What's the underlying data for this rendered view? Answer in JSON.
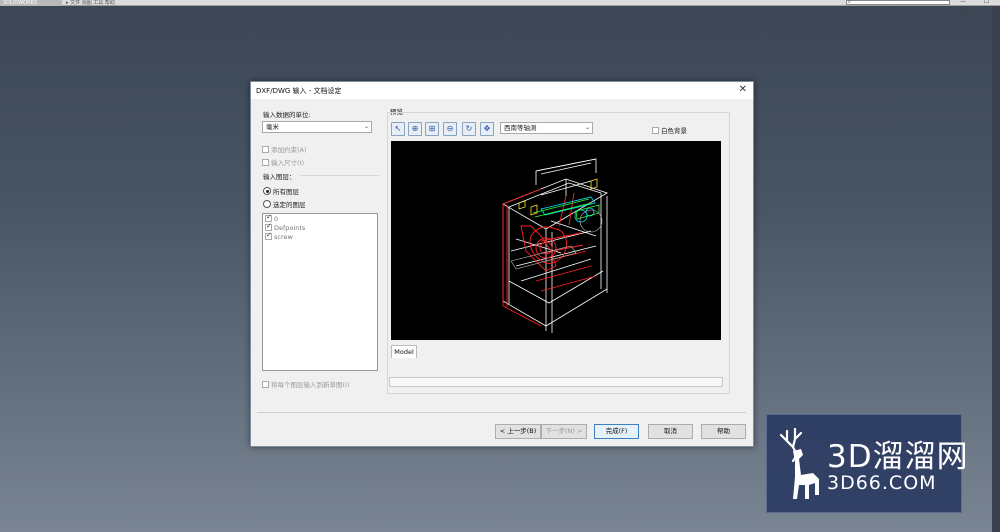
{
  "app": {
    "name": "SOLIDWORKS",
    "menus": "▸  文件  视图  工具  帮助",
    "window_controls": "—  ☐  ✕"
  },
  "dialog": {
    "title": "DXF/DWG 输入 - 文档设定",
    "close_glyph": "✕",
    "units_label": "输入数据的单位:",
    "units_value": "毫米",
    "add_constraints": "添加约束(A)",
    "import_dimensions": "输入尺寸(I)",
    "import_layers_label": "输入图层：",
    "all_layers": "所有图层",
    "selected_layers": "选定的图层",
    "layers": [
      {
        "name": "0",
        "checked": true
      },
      {
        "name": "Defpoints",
        "checked": true
      },
      {
        "name": "screw",
        "checked": true
      }
    ],
    "each_layer_new_sketch": "将每个图层输入到新草图(I)",
    "preview_label": "预览",
    "view_combo": "西南等轴测",
    "white_background": "白色背景",
    "model_tab": "Model",
    "buttons": {
      "back": "< 上一步(B)",
      "next": "下一步(N) >",
      "finish": "完成(F)",
      "cancel": "取消",
      "help": "帮助"
    }
  },
  "watermark": {
    "cn": "3D溜溜网",
    "en": "3D66.COM"
  },
  "colors": {
    "desktop": "#46505e",
    "preview_bg": "#000000",
    "default_button_border": "#3c7fc1"
  }
}
